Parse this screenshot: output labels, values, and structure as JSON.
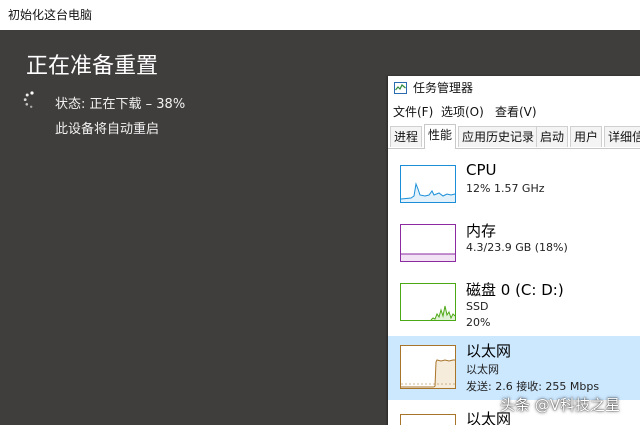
{
  "reset_window": {
    "title": "初始化这台电脑",
    "heading": "正在准备重置",
    "status": "状态: 正在下载 – 38%",
    "restart_note": "此设备将自动重启",
    "spinner_icon": "loading-spinner-icon"
  },
  "task_manager": {
    "title": "任务管理器",
    "app_icon": "task-manager-icon",
    "menu": [
      "文件(F)",
      "选项(O)",
      "查看(V)"
    ],
    "tabs": [
      "进程",
      "性能",
      "应用历史记录",
      "启动",
      "用户",
      "详细信"
    ],
    "active_tab": "性能",
    "items": [
      {
        "name": "CPU",
        "line1": "12% 1.57 GHz",
        "line2": "",
        "line3": "",
        "color": "#1a8fd8"
      },
      {
        "name": "内存",
        "line1": "4.3/23.9 GB (18%)",
        "line2": "",
        "line3": "",
        "color": "#8b2aa1"
      },
      {
        "name": "磁盘 0 (C: D:)",
        "line1": "SSD",
        "line2": "20%",
        "line3": "",
        "color": "#4da816"
      },
      {
        "name": "以太网",
        "line1": "以太网",
        "line2": "发送: 2.6 接收: 255 Mbps",
        "line3": "",
        "color": "#a8742a"
      },
      {
        "name": "以太网",
        "line1": "",
        "line2": "",
        "line3": "",
        "color": "#a8742a"
      }
    ]
  },
  "watermark": "头条 @V科技之星",
  "colors": {
    "background": "#403e3c",
    "selected_row": "#cce8ff",
    "text_light": "#ffffff"
  }
}
